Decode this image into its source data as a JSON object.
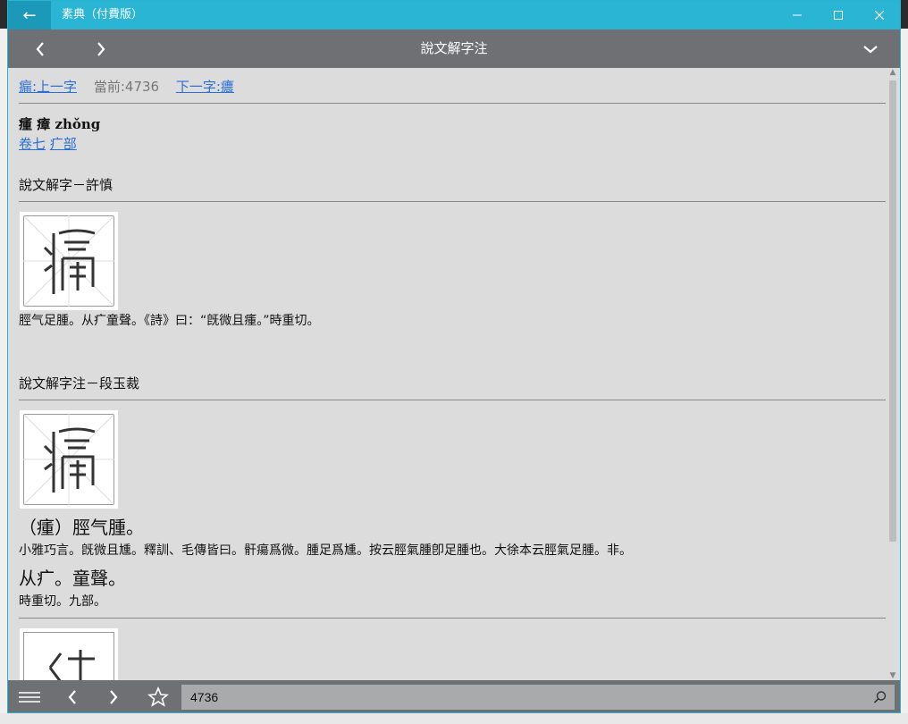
{
  "titlebar": {
    "title": "素典（付費版）"
  },
  "navbar": {
    "title": "說文解字注"
  },
  "charnav": {
    "prev": "瘺:上一字",
    "current": "當前:4736",
    "next": "下一字:癑"
  },
  "entry": {
    "heading": "瘇 瘴 zhǒng",
    "juan": "卷七",
    "bu": "疒部"
  },
  "section1": {
    "title": "說文解字－許慎",
    "text": "脛气足腫。从疒童聲。《詩》曰：“旣微且瘇。”時重切。"
  },
  "section2": {
    "title": "說文解字注－段玉裁",
    "big1": "（瘇）脛气腫。",
    "text1": "小雅巧言。旣微且尰。釋訓、毛傳皆曰。骭瘍爲微。腫足爲尰。按云脛氣腫卽足腫也。大徐本云脛氣足腫。非。",
    "big2": "从疒。童聲。",
    "text2": "時重切。九部。"
  },
  "search": {
    "value": "4736"
  },
  "colors": {
    "titlebar": "#29b5d3",
    "navbar": "#6f7073",
    "link": "#2a6fd6"
  }
}
